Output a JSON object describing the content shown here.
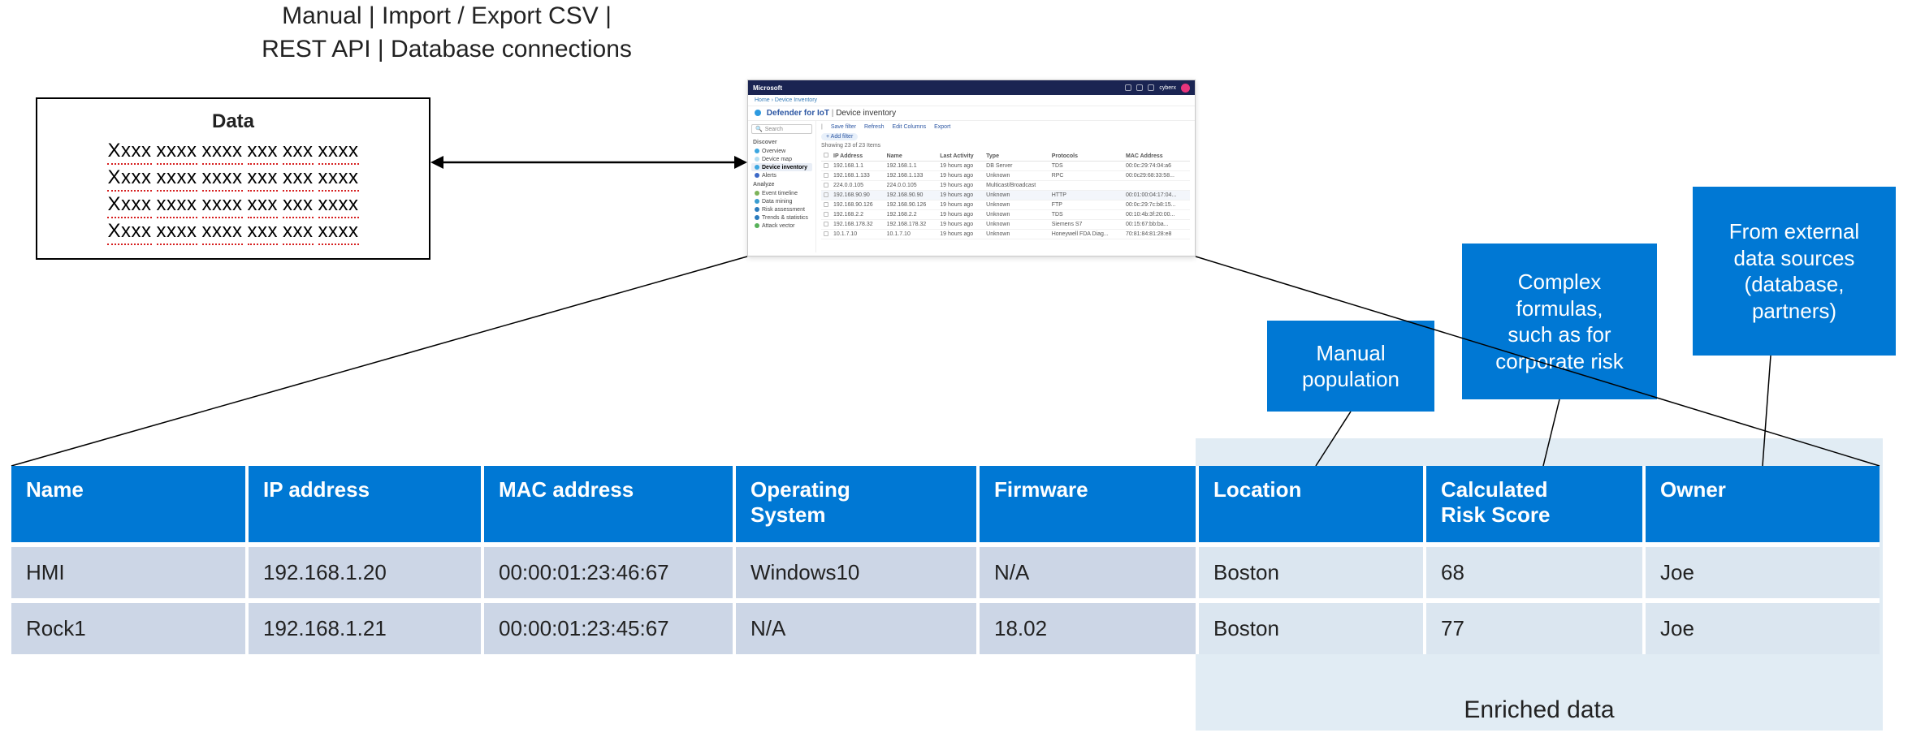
{
  "caption": "Manual | Import / Export CSV |\nREST API | Database connections",
  "data_box": {
    "title": "Data",
    "tokens": [
      "Xxxx",
      "xxxx",
      "xxxx",
      "xxx",
      "xxx",
      "xxxx"
    ],
    "row_count": 4
  },
  "app": {
    "brand": "Microsoft",
    "user": "cyberx",
    "breadcrumb": "Home  ›  Device Inventory",
    "page_title_brand": "Defender for IoT",
    "page_title_section": "Device inventory",
    "search_placeholder": "Search",
    "toolbar": {
      "save_filter": "Save filter",
      "refresh": "Refresh",
      "edit_columns": "Edit Columns",
      "export": "Export"
    },
    "pill": "+ Add filter",
    "showing": "Showing 23 of 23 Items",
    "side": {
      "group1": "Discover",
      "items1": [
        {
          "label": "Overview",
          "c": "c1"
        },
        {
          "label": "Device map",
          "c": "c2"
        },
        {
          "label": "Device inventory",
          "c": "c1",
          "active": true
        },
        {
          "label": "Alerts",
          "c": "c3"
        }
      ],
      "group2": "Analyze",
      "items2": [
        {
          "label": "Event timeline",
          "c": "c4"
        },
        {
          "label": "Data mining",
          "c": "c5"
        },
        {
          "label": "Risk assessment",
          "c": "c6"
        },
        {
          "label": "Trends & statistics",
          "c": "c6"
        },
        {
          "label": "Attack vector",
          "c": "c7"
        }
      ]
    },
    "table": {
      "headers": [
        "IP Address",
        "Name",
        "Last Activity",
        "Type",
        "Protocols",
        "MAC Address"
      ],
      "rows": [
        {
          "hl": false,
          "c": [
            "192.168.1.1",
            "192.168.1.1",
            "19 hours ago",
            "DB Server",
            "TDS",
            "00:0c:29:74:04:a6"
          ]
        },
        {
          "hl": false,
          "c": [
            "192.168.1.133",
            "192.168.1.133",
            "19 hours ago",
            "Unknown",
            "RPC",
            "00:0c29:68:33:58..."
          ]
        },
        {
          "hl": false,
          "c": [
            "224.0.0.105",
            "224.0.0.105",
            "19 hours ago",
            "Multicast/Broadcast",
            "",
            ""
          ]
        },
        {
          "hl": true,
          "c": [
            "192.168.90.90",
            "192.168.90.90",
            "19 hours ago",
            "Unknown",
            "HTTP",
            "00:01:00:04:17:04..."
          ]
        },
        {
          "hl": false,
          "c": [
            "192.168.90.126",
            "192.168.90.126",
            "19 hours ago",
            "Unknown",
            "FTP",
            "00:0c:29:7c:b8:15..."
          ]
        },
        {
          "hl": false,
          "c": [
            "192.168.2.2",
            "192.168.2.2",
            "19 hours ago",
            "Unknown",
            "TDS",
            "00:10:4b:3f:20:00..."
          ]
        },
        {
          "hl": false,
          "c": [
            "192.168.178.32",
            "192.168.178.32",
            "19 hours ago",
            "Unknown",
            "Siemens S7",
            "00:15:67:bb:ba..."
          ]
        },
        {
          "hl": false,
          "c": [
            "10.1.7.10",
            "10.1.7.10",
            "19 hours ago",
            "Unknown",
            "Honeywell FDA Diag...",
            "70:81:84:81:28:e8"
          ]
        }
      ]
    }
  },
  "callouts": {
    "manual": "Manual\npopulation",
    "formula": "Complex\nformulas,\nsuch as for\ncorporate risk",
    "external": "From external\ndata sources\n(database,\npartners)"
  },
  "enriched_label": "Enriched data",
  "main_table": {
    "headers": [
      "Name",
      "IP address",
      "MAC address",
      "Operating\nSystem",
      "Firmware",
      "Location",
      "Calculated\nRisk Score",
      "Owner"
    ],
    "rows": [
      {
        "name": "HMI",
        "ip": "192.168.1.20",
        "mac": "00:00:01:23:46:67",
        "os": "Windows10",
        "fw": "N/A",
        "loc": "Boston",
        "risk": "68",
        "owner": "Joe"
      },
      {
        "name": "Rock1",
        "ip": "192.168.1.21",
        "mac": "00:00:01:23:45:67",
        "os": "N/A",
        "fw": "18.02",
        "loc": "Boston",
        "risk": "77",
        "owner": "Joe"
      }
    ]
  }
}
